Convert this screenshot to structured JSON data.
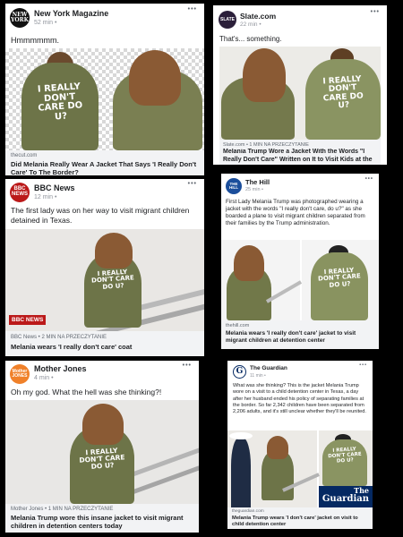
{
  "posts": [
    {
      "source": "New York Magazine",
      "avatar_text": "NEW YORK",
      "time": "52 min",
      "text": "Hmmmmmm.",
      "photo_text_back": "I REALLY DON'T CARE DO U?",
      "link_domain": "thecut.com",
      "link_headline": "Did Melania Really Wear A Jacket That Says 'I Really Don't Care' To The Border?"
    },
    {
      "source": "Slate.com",
      "avatar_text": "SLATE",
      "time": "22 min",
      "text": "That's... something.",
      "photo_text_back": "I REALLY DON'T CARE DO U?",
      "link_domain": "Slate.com • 1 MIN NA PRZECZYTANIE",
      "link_headline": "Melania Trump Wore a Jacket With the Words \"I Really Don't Care\" Written on It to Visit Kids at the B..."
    },
    {
      "source": "BBC News",
      "avatar_text": "BBC NEWS",
      "time": "12 min",
      "text": "The first lady was on her way to visit migrant children detained in Texas.",
      "photo_text_back": "I REALLY DON'T CARE DO U?",
      "photo_logo": "BBC NEWS",
      "link_domain": "BBC News • 2 MIN NA PRZECZYTANIE",
      "link_headline": "Melania wears 'I really don't care' coat"
    },
    {
      "source": "The Hill",
      "avatar_text": "THE HILL",
      "time": "25 min",
      "text": "First Lady Melania Trump was photographed wearing a jacket with the words \"I really don't care, do u?\" as she boarded a plane to visit migrant children separated from their families by the Trump administration.",
      "photo_text_back": "I REALLY DON'T CARE DO U?",
      "link_domain": "thehill.com",
      "link_headline": "Melania wears 'I really don't care' jacket to visit migrant children at detention center"
    },
    {
      "source": "Mother Jones",
      "avatar_text": "Mother JONES",
      "time": "4 min",
      "text": "Oh my god. What the hell was she thinking?!",
      "photo_text_back": "I REALLY DON'T CARE DO U?",
      "link_domain": "Mother Jones • 1 MIN NA PRZECZYTANIE",
      "link_headline": "Melania Trump wore this insane jacket to visit migrant children in detention centers today"
    },
    {
      "source": "The Guardian",
      "avatar_text": "G",
      "time": "11 min",
      "text": "What was she thinking? This is the jacket Melania Trump wore on a visit to a child detention center in Texas, a day after her husband ended his policy of separating families at the border. So far 2,342 children have been separated from 2,206 adults, and it's still unclear whether they'll be reunited.",
      "photo_text_back": "I REALLY DON'T CARE DO U?",
      "photo_logo_line1": "The",
      "photo_logo_line2": "Guardian",
      "link_domain": "theguardian.com",
      "link_headline": "Melania Trump wears 'I don't care' jacket on visit to child detention center"
    }
  ],
  "ui": {
    "more_glyph": "•••",
    "globe_glyph": "•"
  },
  "colors": {
    "background": "#000000",
    "card": "#ffffff",
    "link_bar": "#f2f3f5",
    "meta": "#90949c",
    "jacket": "#6d7448",
    "bbc_red": "#bb1919",
    "hill_blue": "#1b4e9b",
    "slate_dark": "#2b1f3a",
    "motherjones_orange": "#f0812a",
    "guardian_navy": "#052962"
  }
}
